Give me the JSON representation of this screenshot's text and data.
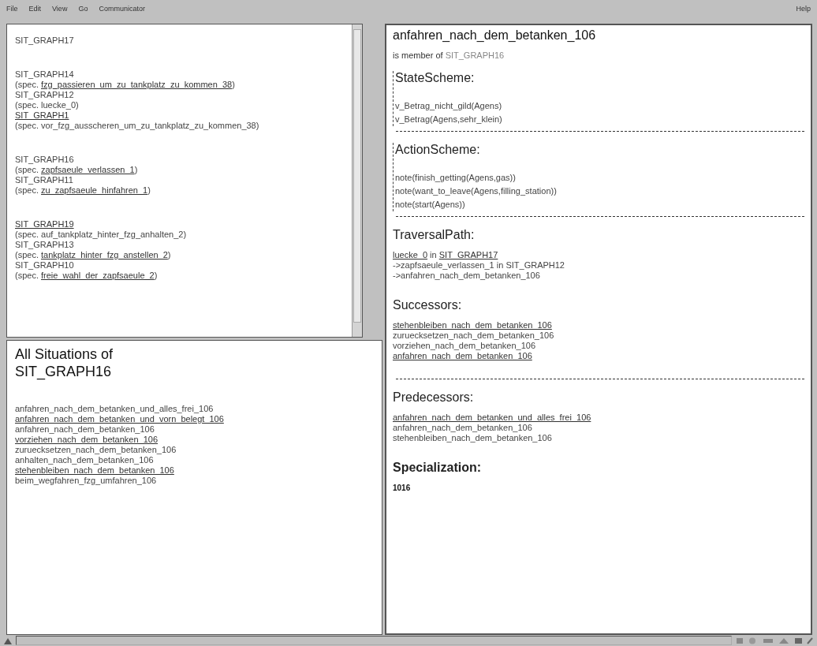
{
  "menu_bar": {
    "items": [
      "File",
      "Edit",
      "View",
      "Go",
      "Communicator"
    ],
    "help": "Help"
  },
  "graph_list": {
    "groups": [
      [
        {
          "graph": "SIT_GRAPH17",
          "graph_link": false
        }
      ],
      [
        {
          "graph": "SIT_GRAPH14",
          "graph_link": false,
          "spec_prefix": "(spec. ",
          "spec": "fzg_passieren_um_zu_tankplatz_zu_kommen_38",
          "spec_link": true,
          "spec_suffix": ")"
        },
        {
          "graph": "SIT_GRAPH12",
          "graph_link": false,
          "spec_prefix": "(spec. ",
          "spec": "luecke_0",
          "spec_link": false,
          "spec_suffix": ")"
        },
        {
          "graph": "SIT_GRAPH1",
          "graph_link": true,
          "spec_prefix": "(spec. ",
          "spec": "vor_fzg_ausscheren_um_zu_tankplatz_zu_kommen_38",
          "spec_link": false,
          "spec_suffix": ")"
        }
      ],
      [
        {
          "graph": "SIT_GRAPH16",
          "graph_link": false,
          "spec_prefix": "(spec. ",
          "spec": "zapfsaeule_verlassen_1",
          "spec_link": true,
          "spec_suffix": ")"
        },
        {
          "graph": "SIT_GRAPH11",
          "graph_link": false,
          "spec_prefix": "(spec. ",
          "spec": "zu_zapfsaeule_hinfahren_1",
          "spec_link": true,
          "spec_suffix": ")"
        }
      ],
      [
        {
          "graph": "SIT_GRAPH19",
          "graph_link": true,
          "spec_prefix": "(spec. ",
          "spec": "auf_tankplatz_hinter_fzg_anhalten_2",
          "spec_link": false,
          "spec_suffix": ")"
        },
        {
          "graph": "SIT_GRAPH13",
          "graph_link": false,
          "spec_prefix": "(spec. ",
          "spec": "tankplatz_hinter_fzg_anstellen_2",
          "spec_link": true,
          "spec_suffix": ")"
        },
        {
          "graph": "SIT_GRAPH10",
          "graph_link": false,
          "spec_prefix": "(spec. ",
          "spec": "freie_wahl_der_zapfsaeule_2",
          "spec_link": true,
          "spec_suffix": ")"
        }
      ]
    ]
  },
  "situations": {
    "title": "All Situations of SIT_GRAPH16",
    "items": [
      {
        "text": "anfahren_nach_dem_betanken_und_alles_frei_106",
        "link": false
      },
      {
        "text": "anfahren_nach_dem_betanken_und_vorn_belegt_106",
        "link": true
      },
      {
        "text": "anfahren_nach_dem_betanken_106",
        "link": false
      },
      {
        "text": "vorziehen_nach_dem_betanken_106",
        "link": true
      },
      {
        "text": "zuruecksetzen_nach_dem_betanken_106",
        "link": false
      },
      {
        "text": "anhalten_nach_dem_betanken_106",
        "link": false
      },
      {
        "text": "stehenbleiben_nach_dem_betanken_106",
        "link": true
      },
      {
        "text": "beim_wegfahren_fzg_umfahren_106",
        "link": false
      }
    ]
  },
  "detail": {
    "title": "anfahren_nach_dem_betanken_106",
    "member_label": "is member of",
    "member_of": "SIT_GRAPH16",
    "sections": [
      {
        "heading": "StateScheme:",
        "kind": "scheme",
        "lines": [
          "v_Betrag_nicht_gild(Agens)",
          "v_Betrag(Agens,sehr_klein)"
        ]
      },
      {
        "heading": "ActionScheme:",
        "kind": "scheme",
        "lines": [
          "note(finish_getting(Agens,gas))",
          "note(want_to_leave(Agens,filling_station))",
          "note(start(Agens))"
        ]
      },
      {
        "heading": "TraversalPath:",
        "kind": "path",
        "steps": [
          [
            {
              "text": "luecke_0",
              "link": true
            },
            {
              "text": " in ",
              "link": false
            },
            {
              "text": "SIT_GRAPH17",
              "link": true
            }
          ],
          [
            {
              "text": "->zapfsaeule_verlassen_1 in SIT_GRAPH12",
              "link": false
            }
          ],
          [
            {
              "text": "->anfahren_nach_dem_betanken_106",
              "link": false
            }
          ]
        ]
      },
      {
        "heading": "Successors:",
        "kind": "list",
        "items": [
          {
            "text": "stehenbleiben_nach_dem_betanken_106",
            "link": true
          },
          {
            "text": "zuruecksetzen_nach_dem_betanken_106",
            "link": false
          },
          {
            "text": "vorziehen_nach_dem_betanken_106",
            "link": false
          },
          {
            "text": "anfahren_nach_dem_betanken_106",
            "link": true
          }
        ]
      },
      {
        "heading": "Predecessors:",
        "kind": "list",
        "items": [
          {
            "text": "anfahren_nach_dem_betanken_und_alles_frei_106",
            "link": true
          },
          {
            "text": "anfahren_nach_dem_betanken_106",
            "link": false
          },
          {
            "text": "stehenbleiben_nach_dem_betanken_106",
            "link": false
          }
        ]
      },
      {
        "heading": "Specialization:",
        "kind": "value",
        "value": "1016"
      }
    ]
  }
}
